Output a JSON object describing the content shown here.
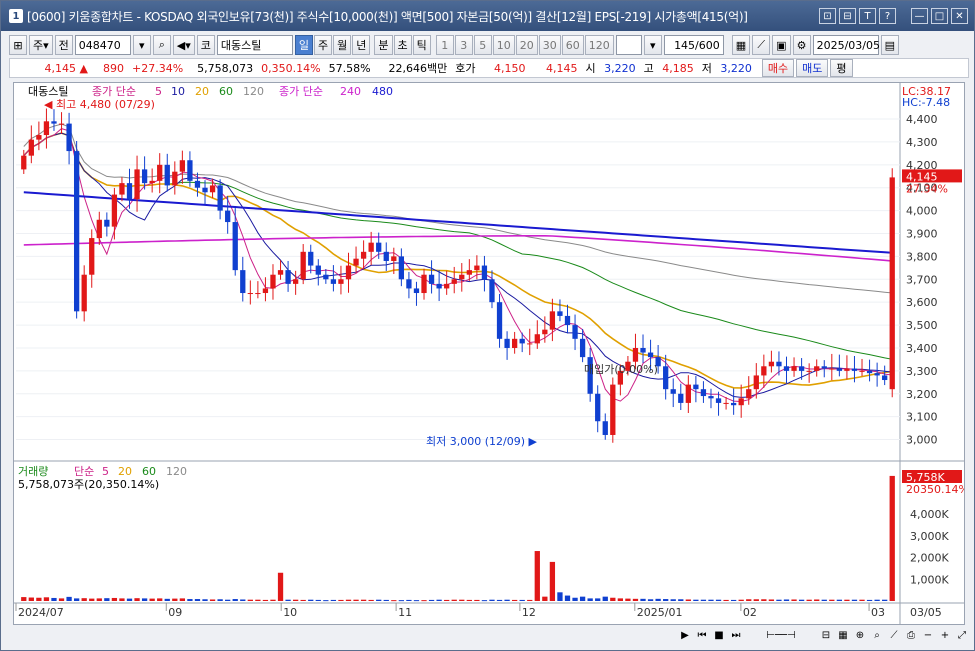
{
  "titlebar": {
    "number": "1",
    "title": "[0600] 키움종합차트 - KOSDAQ 외국인보유[73(천)] 주식수[10,000(천)] 액면[500] 자본금[50(억)] 결산[12월] EPS[-219] 시가총액[415(억)]",
    "icons": [
      "window-icon",
      "restore-icon",
      "pin-icon",
      "help-icon",
      "minimize-icon",
      "maximize-icon",
      "close-icon"
    ],
    "icon_glyphs": [
      "⊡",
      "⊟",
      "T",
      "?",
      "—",
      "□",
      "✕"
    ]
  },
  "toolbar": {
    "period_label": "주",
    "prev_label": "전",
    "code": "048470",
    "market_label": "코",
    "stock_name": "대동스틸",
    "periods": [
      "일",
      "주",
      "월",
      "년",
      "분",
      "초",
      "틱"
    ],
    "active_period": "일",
    "intervals": [
      "1",
      "3",
      "5",
      "10",
      "20",
      "30",
      "60",
      "120"
    ],
    "count": "145/600",
    "date": "2025/03/05"
  },
  "info": {
    "price": "4,145",
    "change": "890",
    "change_pct": "+27.34%",
    "volume": "5,758,073",
    "turnover": "0,350.14%",
    "ratio": "57.58%",
    "amount": "22,646백만",
    "hoga_label": "호가",
    "ask": "4,150",
    "bid": "4,145",
    "open_label": "시",
    "open": "3,220",
    "high_label": "고",
    "high": "4,185",
    "low_label": "저",
    "low": "3,220",
    "buy_label": "매수",
    "sell_label": "매도",
    "eval_label": "평"
  },
  "legend": {
    "stock": "대동스틸",
    "ma_group": "종가 단순",
    "ma_periods": [
      "5",
      "10",
      "20",
      "60",
      "120"
    ],
    "ma_colors": [
      "#cc2288",
      "#1a1aa0",
      "#e0a000",
      "#1a8a1a",
      "#8a8a8a"
    ],
    "long_ma_group": "종가 단순",
    "long_ma_periods": [
      "240",
      "480"
    ],
    "long_ma_colors": [
      "#cc22cc",
      "#1a1ad0"
    ],
    "high_note": "최고 4,480 (07/29)",
    "low_note": "최저 3,000 (12/09)",
    "avg_note": "매입가(0,00%)",
    "lc": "LC:38.17",
    "hc": "HC:-7.48",
    "current_price_tag": "4,145",
    "current_pct_tag": "27.34%"
  },
  "volume_legend": {
    "label": "거래량",
    "ma_group": "단순",
    "ma_periods": [
      "5",
      "20",
      "60",
      "120"
    ],
    "value": "5,758,073주(20,350.14%)",
    "vol_tag": "5,758K",
    "vol_pct_tag": "20350.14%"
  },
  "chart_data": {
    "type": "candlestick",
    "price_axis": [
      "4,400",
      "4,300",
      "4,200",
      "4,100",
      "4,000",
      "3,900",
      "3,800",
      "3,700",
      "3,600",
      "3,500",
      "3,400",
      "3,300",
      "3,200",
      "3,100",
      "3,000"
    ],
    "price_range": [
      2950,
      4470
    ],
    "volume_axis": [
      "4,000K",
      "3,000K",
      "2,000K",
      "1,000K"
    ],
    "volume_range": [
      0,
      5800
    ],
    "x_labels": [
      "2024/07",
      "09",
      "10",
      "11",
      "12",
      "2025/01",
      "02",
      "03",
      "03/05"
    ],
    "close": [
      4240,
      4310,
      4330,
      4390,
      4380,
      4380,
      4260,
      3560,
      3720,
      3880,
      3960,
      3930,
      4070,
      4120,
      4050,
      4180,
      4120,
      4130,
      4200,
      4110,
      4170,
      4220,
      4130,
      4100,
      4080,
      4110,
      4000,
      3950,
      3740,
      3640,
      3640,
      3640,
      3660,
      3720,
      3740,
      3680,
      3700,
      3820,
      3760,
      3720,
      3700,
      3680,
      3700,
      3760,
      3790,
      3820,
      3860,
      3820,
      3780,
      3800,
      3700,
      3660,
      3640,
      3720,
      3680,
      3660,
      3680,
      3700,
      3720,
      3740,
      3760,
      3700,
      3600,
      3440,
      3400,
      3440,
      3420,
      3420,
      3460,
      3480,
      3560,
      3540,
      3500,
      3440,
      3360,
      3200,
      3080,
      3020,
      3240,
      3300,
      3340,
      3400,
      3380,
      3360,
      3320,
      3220,
      3200,
      3160,
      3240,
      3220,
      3190,
      3180,
      3160,
      3160,
      3150,
      3180,
      3220,
      3280,
      3320,
      3340,
      3320,
      3300,
      3320,
      3300,
      3300,
      3320,
      3310,
      3310,
      3300,
      3310,
      3300,
      3300,
      3290,
      3280,
      3260,
      4145
    ],
    "volume": [
      180,
      160,
      150,
      170,
      140,
      120,
      190,
      120,
      130,
      110,
      120,
      130,
      140,
      120,
      110,
      130,
      120,
      110,
      120,
      100,
      110,
      120,
      90,
      90,
      80,
      70,
      80,
      60,
      90,
      70,
      60,
      60,
      50,
      60,
      1300,
      60,
      60,
      50,
      60,
      50,
      40,
      50,
      50,
      60,
      60,
      60,
      50,
      60,
      50,
      40,
      40,
      50,
      40,
      40,
      50,
      60,
      50,
      60,
      60,
      50,
      50,
      40,
      60,
      50,
      60,
      50,
      50,
      50,
      2300,
      200,
      1800,
      400,
      250,
      150,
      200,
      120,
      120,
      200,
      150,
      120,
      110,
      100,
      100,
      80,
      100,
      90,
      80,
      80,
      70,
      60,
      60,
      60,
      60,
      50,
      50,
      60,
      80,
      80,
      80,
      70,
      60,
      70,
      70,
      60,
      60,
      70,
      60,
      60,
      60,
      60,
      60,
      60,
      50,
      60,
      60,
      5758
    ]
  }
}
